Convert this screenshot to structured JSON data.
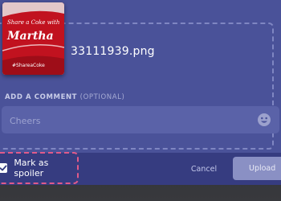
{
  "file": {
    "name": "33111939.png",
    "thumbnail_text": {
      "line1": "Share a Coke with",
      "name": "Martha",
      "hashtag": "#ShareaCoke"
    }
  },
  "comment": {
    "label": "ADD A COMMENT",
    "optional": "(OPTIONAL)",
    "placeholder": "Cheers"
  },
  "spoiler": {
    "label": "Mark as spoiler",
    "checked": true
  },
  "buttons": {
    "cancel": "Cancel",
    "upload": "Upload"
  },
  "colors": {
    "modal": "#4a5299",
    "footer": "#363c80",
    "spoiler_border": "#e05a8a",
    "upload_button": "#8a90c4"
  }
}
